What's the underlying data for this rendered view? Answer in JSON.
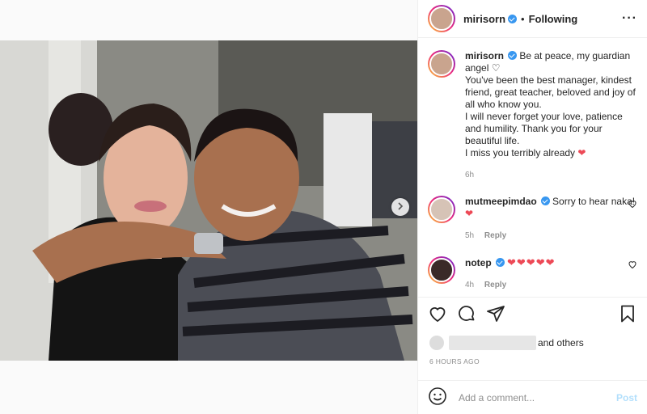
{
  "post": {
    "username": "mirisorn",
    "follow_status": "Following",
    "more_label": "···"
  },
  "caption": {
    "username": "mirisorn",
    "lines": [
      "Be at peace, my guardian angel",
      "You've been the best manager, kindest friend, great teacher, beloved and joy of all who know you.",
      "I will never forget your love, patience and humility. Thank you for your beautiful life.",
      "I miss you terribly already"
    ],
    "time": "6h"
  },
  "comments": [
    {
      "username": "mutmeepimdao",
      "text": "Sorry to hear naka!",
      "time": "5h",
      "reply_label": "Reply"
    },
    {
      "username": "notep",
      "text": "",
      "hearts": "❤❤❤❤❤",
      "time": "4h",
      "reply_label": "Reply"
    }
  ],
  "likes": {
    "suffix": "and others"
  },
  "timestamp": "6 HOURS AGO",
  "composer": {
    "placeholder": "Add a comment...",
    "post_label": "Post"
  },
  "icons": [
    "emoji-icon",
    "heart-icon",
    "comment-icon",
    "share-icon",
    "bookmark-icon",
    "chevron-right-icon",
    "verified-icon"
  ],
  "colors": {
    "verified": "#3897f0",
    "heart": "#ed4956",
    "post_disabled": "#b2dffc",
    "muted": "#8e8e8e"
  }
}
